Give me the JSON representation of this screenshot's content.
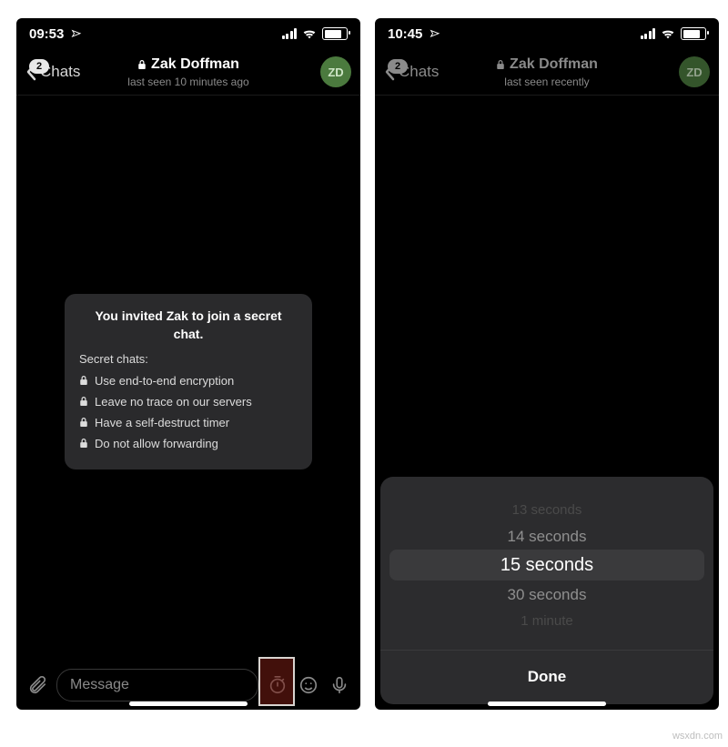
{
  "left": {
    "status": {
      "time": "09:53"
    },
    "nav": {
      "back_label": "Chats",
      "badge": "2",
      "title": "Zak Doffman",
      "subtitle": "last seen 10 minutes ago",
      "avatar_initials": "ZD"
    },
    "bubble": {
      "headline": "You invited Zak to join a secret chat.",
      "subtitle": "Secret chats:",
      "items": [
        "Use end-to-end encryption",
        "Leave no trace on our servers",
        "Have a self-destruct timer",
        "Do not allow forwarding"
      ]
    },
    "input": {
      "placeholder": "Message"
    }
  },
  "right": {
    "status": {
      "time": "10:45"
    },
    "nav": {
      "back_label": "Chats",
      "badge": "2",
      "title": "Zak Doffman",
      "subtitle": "last seen recently",
      "avatar_initials": "ZD"
    },
    "picker": {
      "options": [
        "13 seconds",
        "14 seconds",
        "15 seconds",
        "30 seconds",
        "1 minute"
      ],
      "selected_index": 2,
      "done_label": "Done"
    }
  },
  "watermark": "wsxdn.com"
}
